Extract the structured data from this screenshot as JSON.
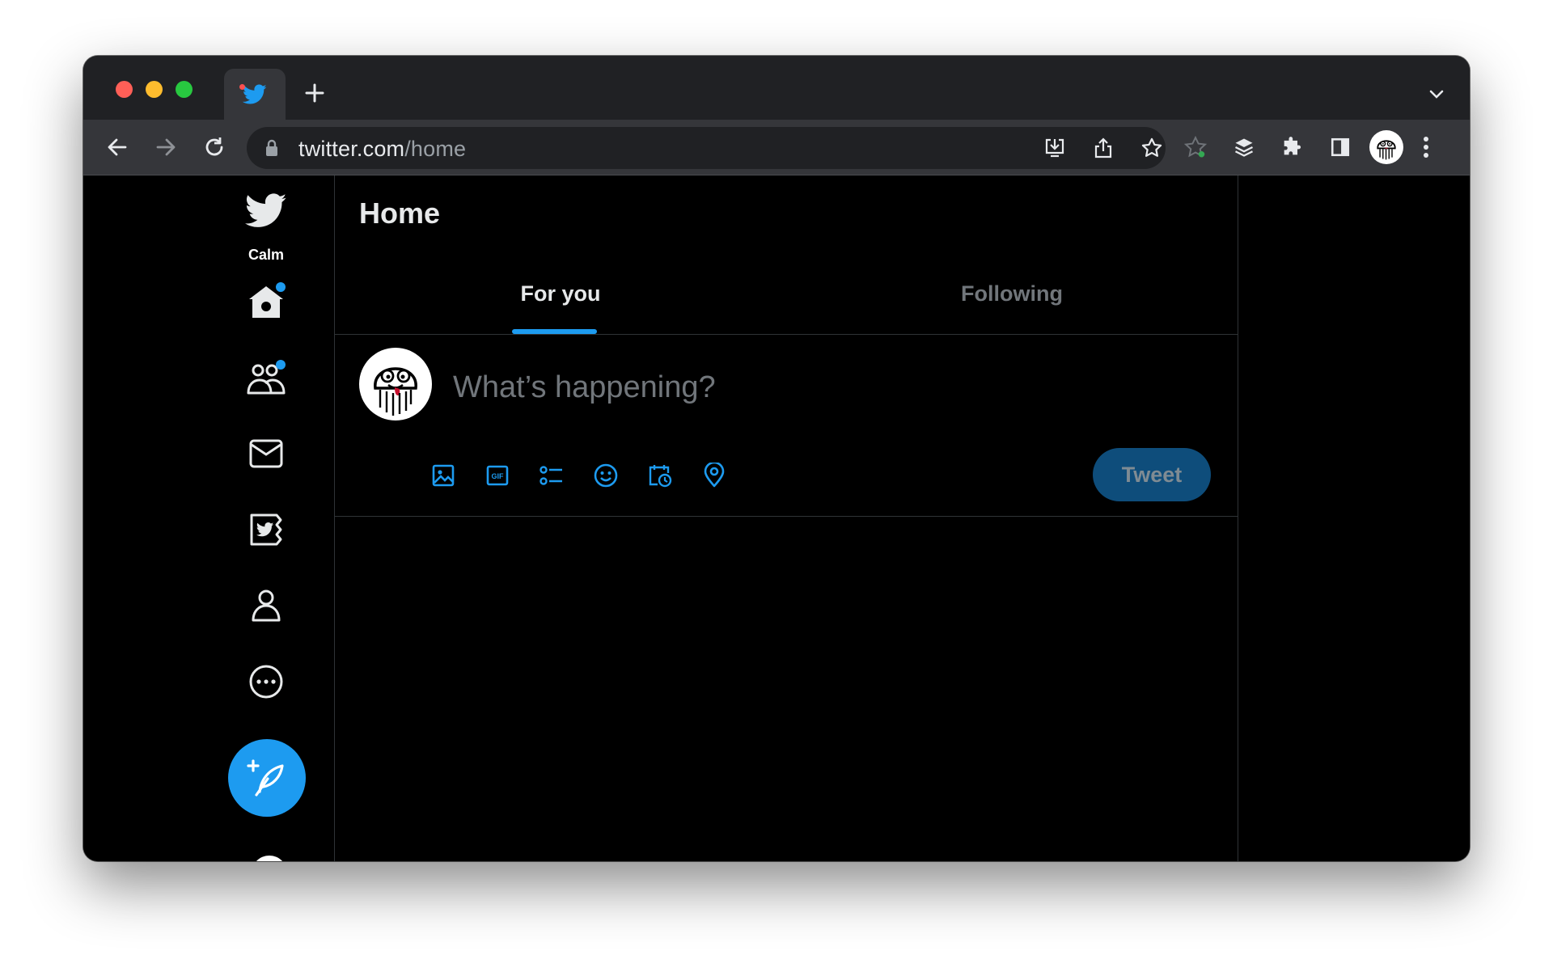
{
  "browser": {
    "tab_icon": "twitter-bird-icon",
    "url_host": "twitter.com",
    "url_path": "/home"
  },
  "sidebar": {
    "label": "Calm",
    "items": [
      {
        "icon": "home-icon",
        "badge": true
      },
      {
        "icon": "communities-icon",
        "badge": true
      },
      {
        "icon": "messages-icon"
      },
      {
        "icon": "twitter-blue-icon"
      },
      {
        "icon": "profile-icon"
      },
      {
        "icon": "more-icon"
      }
    ],
    "compose_icon": "compose-tweet-icon"
  },
  "main": {
    "title": "Home",
    "tabs": [
      {
        "label": "For you",
        "active": true
      },
      {
        "label": "Following",
        "active": false
      }
    ],
    "composer": {
      "placeholder": "What’s happening?",
      "tools": [
        "media-icon",
        "gif-icon",
        "poll-icon",
        "emoji-icon",
        "schedule-icon",
        "location-icon"
      ],
      "tweet_label": "Tweet"
    }
  },
  "colors": {
    "accent": "#1d9bf0",
    "background": "#000000",
    "tweet_button_disabled": "#0e4d7b"
  }
}
